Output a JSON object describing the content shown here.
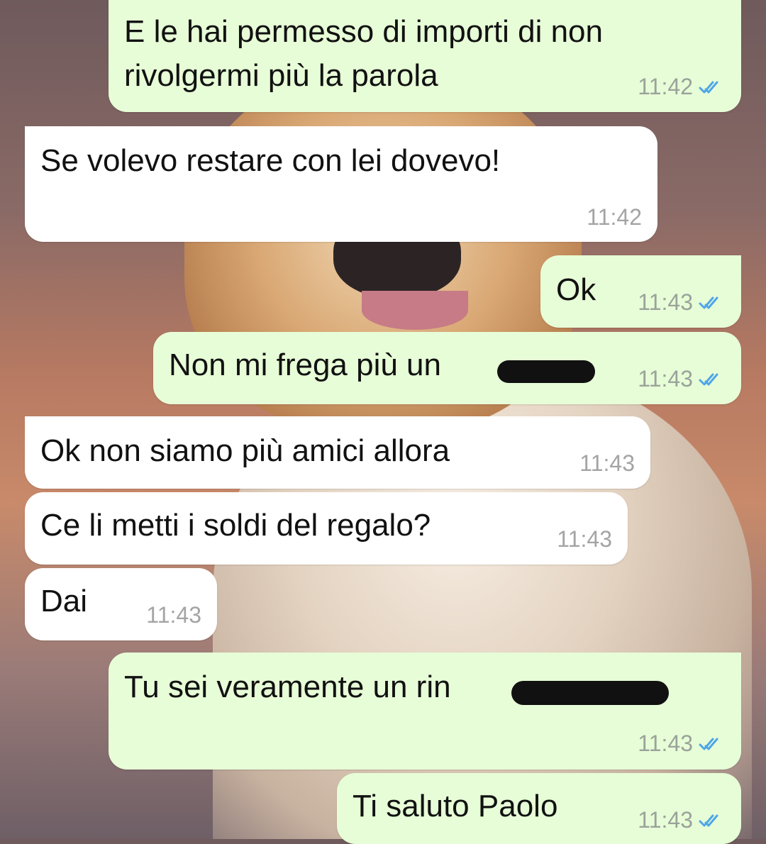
{
  "messages": [
    {
      "dir": "out",
      "text_lines": [
        "E le hai permesso di importi di non",
        "rivolgermi più la parola"
      ],
      "time": "11:42",
      "status": "read"
    },
    {
      "dir": "in",
      "text_lines": [
        "Se volevo restare con lei dovevo!"
      ],
      "time": "11:42"
    },
    {
      "dir": "out",
      "text_lines": [
        "Ok"
      ],
      "time": "11:43",
      "status": "read"
    },
    {
      "dir": "out",
      "text_lines": [
        "Non mi frega più un"
      ],
      "time": "11:43",
      "status": "read",
      "censored": true
    },
    {
      "dir": "in",
      "text_lines": [
        "Ok non siamo più amici allora"
      ],
      "time": "11:43"
    },
    {
      "dir": "in",
      "text_lines": [
        "Ce li metti i soldi del regalo?"
      ],
      "time": "11:43"
    },
    {
      "dir": "in",
      "text_lines": [
        "Dai"
      ],
      "time": "11:43"
    },
    {
      "dir": "out",
      "text_lines": [
        "Tu sei veramente un rin"
      ],
      "time": "11:43",
      "status": "read",
      "censored": true
    },
    {
      "dir": "out",
      "text_lines": [
        "Ti saluto Paolo"
      ],
      "time": "11:43",
      "status": "read"
    }
  ],
  "icons": {
    "read_receipt": "double-check-icon"
  },
  "colors": {
    "outgoing_bubble": "#e7fdd7",
    "incoming_bubble": "#ffffff",
    "tick_blue": "#4fa6e8"
  }
}
